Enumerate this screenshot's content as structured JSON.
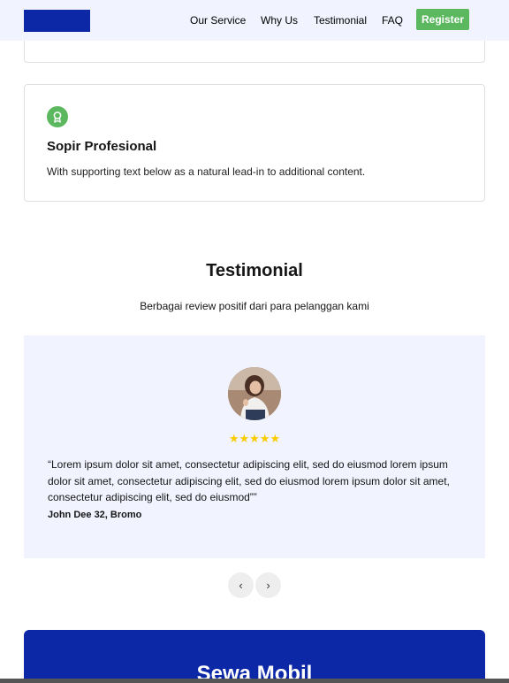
{
  "nav": {
    "links": [
      "Our Service",
      "Why Us",
      "Testimonial",
      "FAQ"
    ],
    "register_label": "Register"
  },
  "feature_card": {
    "icon": "award-badge-icon",
    "title": "Sopir Profesional",
    "text": "With supporting text below as a natural lead-in to additional content."
  },
  "testimonial_section": {
    "title": "Testimonial",
    "subtitle": "Berbagai review positif dari para pelanggan kami",
    "rating_stars": "★★★★★",
    "rating": 5,
    "quote": "“Lorem ipsum dolor sit amet, consectetur adipiscing elit, sed do eiusmod lorem ipsum dolor sit amet, consectetur adipiscing elit, sed do eiusmod lorem ipsum dolor sit amet, consectetur adipiscing elit, sed do eiusmod””",
    "author": "John Dee 32, Bromo",
    "prev_label": "‹",
    "next_label": "›"
  },
  "cta": {
    "title": "Sewa Mobil"
  },
  "colors": {
    "brand_blue": "#0d28a6",
    "green": "#5cb85f",
    "light_bg": "#f1f3ff",
    "star": "#f9cc00"
  }
}
